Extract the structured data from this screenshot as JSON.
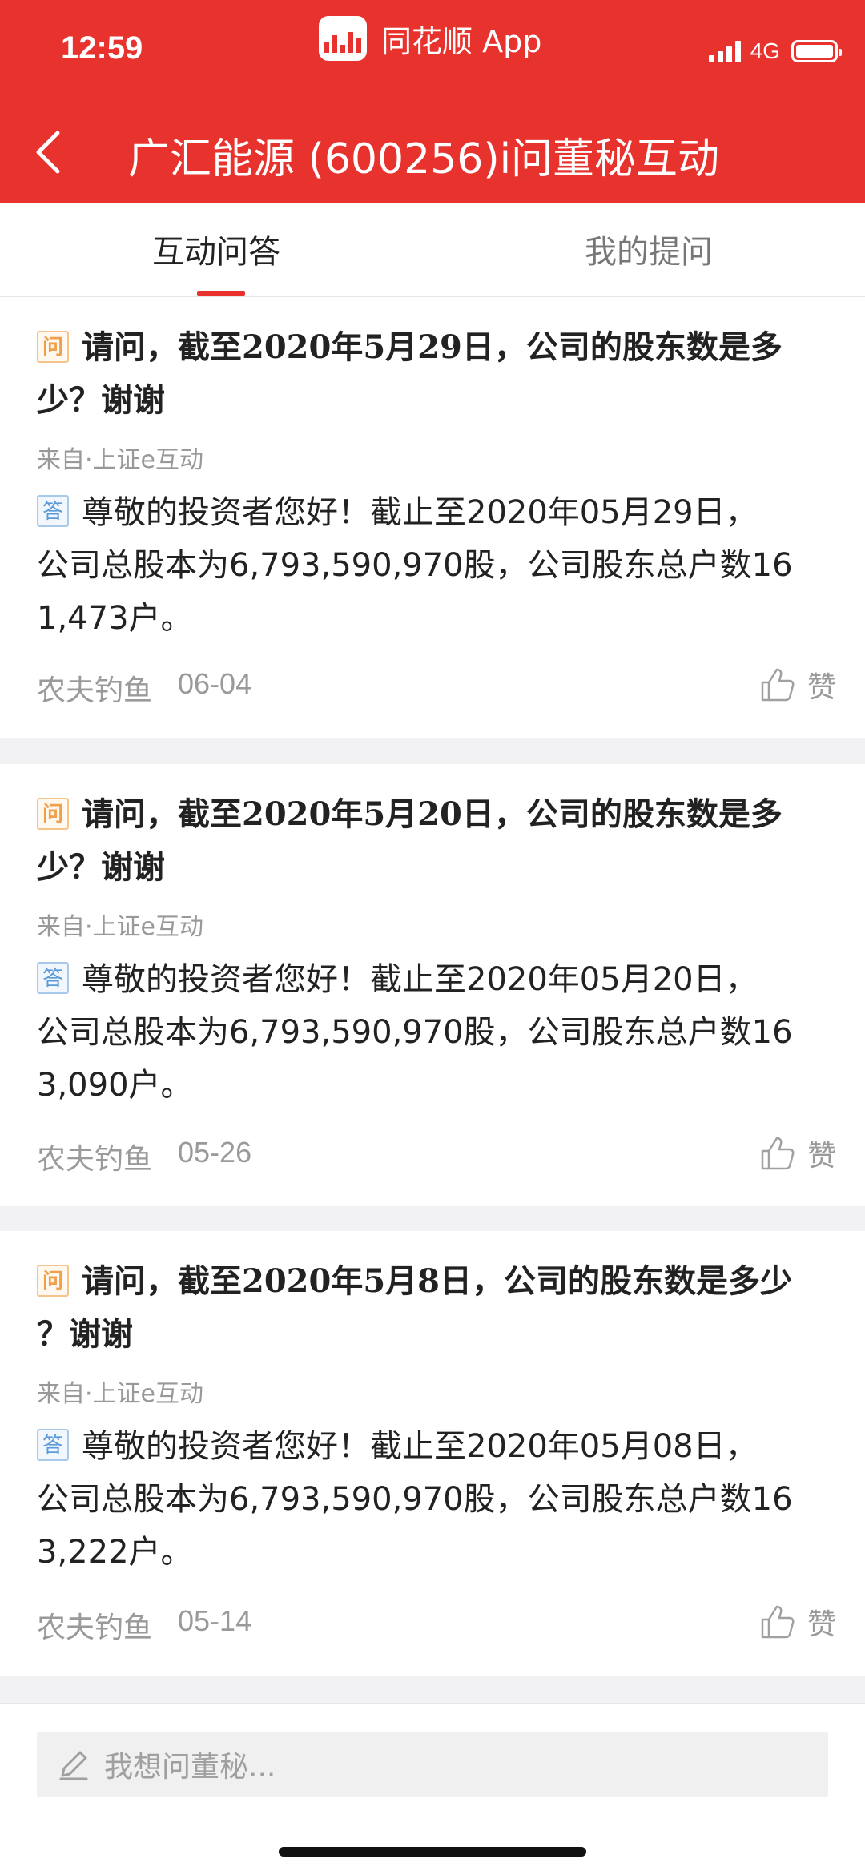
{
  "status": {
    "time": "12:59",
    "app_name": "同花顺 App",
    "network": "4G"
  },
  "nav": {
    "title": "广汇能源 (600256)i问董秘互动"
  },
  "tabs": [
    {
      "label": "互动问答"
    },
    {
      "label": "我的提问"
    }
  ],
  "tags": {
    "question": "问",
    "answer": "答"
  },
  "like_label": "赞",
  "items": [
    {
      "question_line1": "请问，截至2020年5月29日，公司的股东数是多",
      "question_line2": "少？谢谢",
      "source": "来自·上证e互动",
      "answer_line1": "尊敬的投资者您好！截止至2020年05月29日，",
      "answer_line2": "公司总股本为6,793,590,970股，公司股东总户数16",
      "answer_line3": "1,473户。",
      "author": "农夫钓鱼",
      "date": "06-04"
    },
    {
      "question_line1": "请问，截至2020年5月20日，公司的股东数是多",
      "question_line2": "少？谢谢",
      "source": "来自·上证e互动",
      "answer_line1": "尊敬的投资者您好！截止至2020年05月20日，",
      "answer_line2": "公司总股本为6,793,590,970股，公司股东总户数16",
      "answer_line3": "3,090户。",
      "author": "农夫钓鱼",
      "date": "05-26"
    },
    {
      "question_line1": "请问，截至2020年5月8日，公司的股东数是多少",
      "question_line2": "？谢谢",
      "source": "来自·上证e互动",
      "answer_line1": "尊敬的投资者您好！截止至2020年05月08日，",
      "answer_line2": "公司总股本为6,793,590,970股，公司股东总户数16",
      "answer_line3": "3,222户。",
      "author": "农夫钓鱼",
      "date": "05-14"
    }
  ],
  "bottom": {
    "placeholder": "我想问董秘..."
  },
  "colors": {
    "brand": "#e8322e",
    "question_tag": "#f0a04b",
    "answer_tag": "#5a9ad8"
  },
  "icons": [
    "back-arrow-icon",
    "thumbs-up-icon",
    "pencil-icon",
    "signal-icon",
    "battery-icon",
    "app-logo-icon"
  ]
}
